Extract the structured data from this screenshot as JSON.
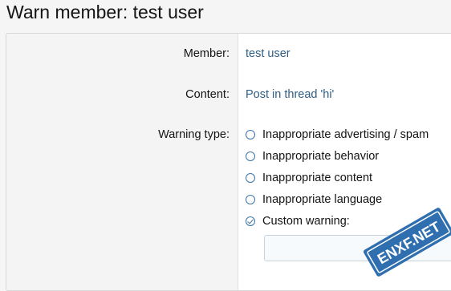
{
  "page": {
    "title": "Warn member: test user"
  },
  "form": {
    "member": {
      "label": "Member:",
      "value": "test user"
    },
    "content": {
      "label": "Content:",
      "value": "Post in thread 'hi'"
    },
    "warning_type": {
      "label": "Warning type:",
      "options": [
        {
          "label": "Inappropriate advertising / spam",
          "checked": false
        },
        {
          "label": "Inappropriate behavior",
          "checked": false
        },
        {
          "label": "Inappropriate content",
          "checked": false
        },
        {
          "label": "Inappropriate language",
          "checked": false
        },
        {
          "label": "Custom warning:",
          "checked": true
        }
      ],
      "custom_value": ""
    }
  },
  "watermark": {
    "text": "ENXF.NET",
    "color": "#2f6fb0"
  }
}
